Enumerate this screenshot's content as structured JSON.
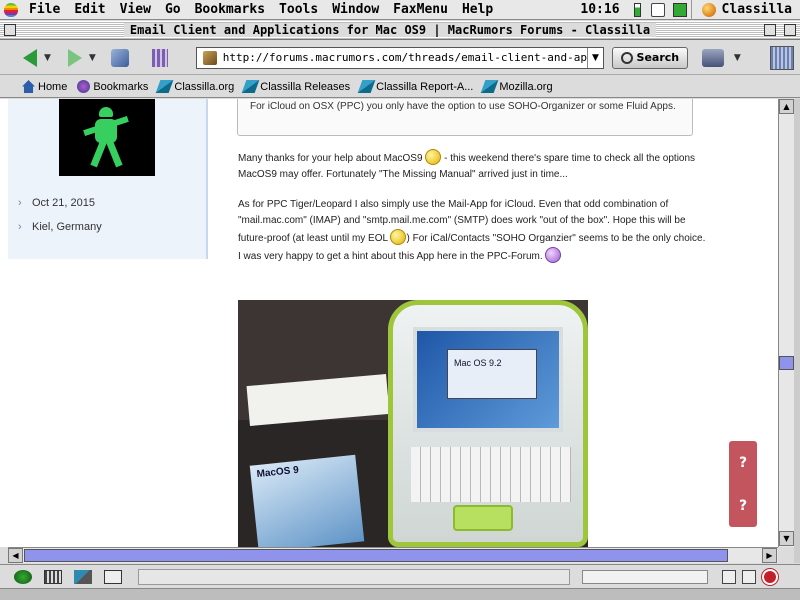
{
  "menubar": {
    "items": [
      "File",
      "Edit",
      "View",
      "Go",
      "Bookmarks",
      "Tools",
      "Window",
      "FaxMenu",
      "Help"
    ],
    "clock": "10:16",
    "app_name": "Classilla"
  },
  "window": {
    "title": "Email Client and Applications for Mac OS9 | MacRumors Forums - Classilla"
  },
  "toolbar": {
    "url": "http://forums.macrumors.com/threads/email-client-and-applications-fo",
    "search_label": "Search"
  },
  "bookmarks_bar": {
    "items": [
      "Home",
      "Bookmarks",
      "Classilla.org",
      "Classilla Releases",
      "Classilla Report-A...",
      "Mozilla.org"
    ]
  },
  "post": {
    "user_date": "Oct 21, 2015",
    "user_location": "Kiel, Germany",
    "quote_text": "For iCloud on OSX (PPC) you only have the option to use SOHO-Organizer or some Fluid Apps.",
    "para1_a": "Many thanks for your help about MacOS9 ",
    "para1_b": " - this weekend there's spare time to check all the options MacOS9 may offer. Fortunately \"The Missing Manual\" arrived just in time...",
    "para2_a": "As for PPC Tiger/Leopard I also simply use the Mail-App for iCloud. Even that odd combination of \"mail.mac.com\" (IMAP) and \"smtp.mail.me.com\" (SMTP) does work \"out of the box\". Hope this will be future-proof (at least until my EOL ",
    "para2_b": ") For iCal/Contacts \"SOHO Organzier\" seems to be the only choice. I was very happy to get a hint about this App here in the PPC-Forum. ",
    "photo_screen_text": "Mac OS 9.2",
    "photo_book_text": "MacOS 9"
  },
  "help_widget": {
    "q1": "?",
    "q2": "?"
  },
  "scroll": {
    "vertical_position_fraction": 0.6
  },
  "colors": {
    "scroll_thumb": "#8f93ec",
    "help_widget": "#c2555d",
    "user_panel": "#edf3fa"
  }
}
